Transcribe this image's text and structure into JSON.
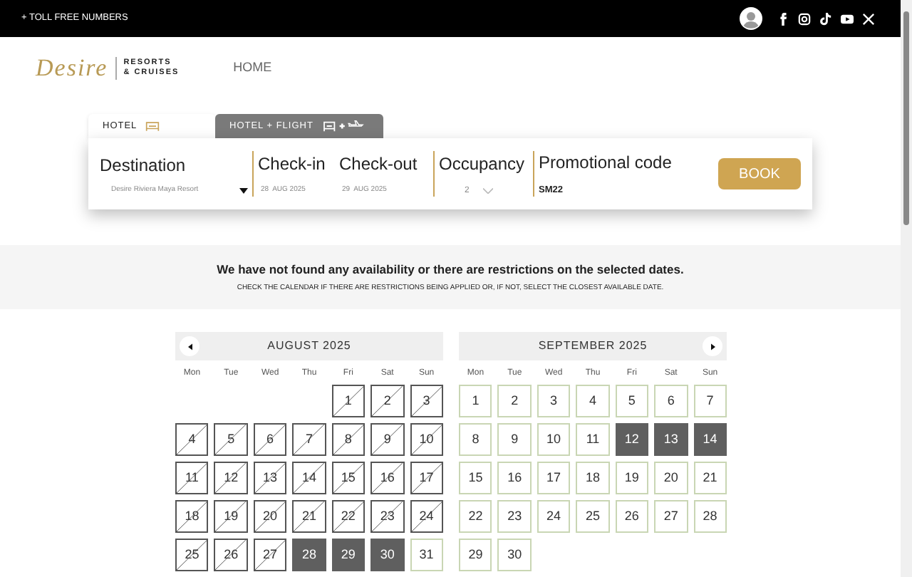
{
  "top_bar": {
    "toll_free": "+ TOLL FREE NUMBERS"
  },
  "header": {
    "logo_script": "Desire",
    "logo_text_1": "RESORTS",
    "logo_text_2": "& CRUISES",
    "nav": [
      "HOME"
    ]
  },
  "tabs": [
    {
      "label": "HOTEL",
      "selected": true
    },
    {
      "label": "HOTEL + FLIGHT",
      "selected": false
    }
  ],
  "search": {
    "destination": {
      "label": "Destination",
      "value": "Desire Riviera Maya Resort"
    },
    "check_in": {
      "label": "Check-in",
      "day": "28",
      "month": "AUG 2025"
    },
    "check_out": {
      "label": "Check-out",
      "day": "29",
      "month": "AUG 2025"
    },
    "occupancy": {
      "label": "Occupancy",
      "value": "2"
    },
    "promo": {
      "label": "Promotional code",
      "value": "SM22"
    },
    "book": "BOOK"
  },
  "notice": {
    "title": "We have not found any availability or there are restrictions on the selected dates.",
    "subtitle": "CHECK THE CALENDAR IF THERE ARE RESTRICTIONS BEING APPLIED OR, IF NOT, SELECT THE CLOSEST AVAILABLE DATE."
  },
  "calendars": [
    {
      "title": "AUGUST 2025",
      "kind": "prev",
      "weekdays": [
        "Mon",
        "Tue",
        "Wed",
        "Thu",
        "Fri",
        "Sat",
        "Sun"
      ],
      "days": [
        {
          "kind": "blank"
        },
        {
          "kind": "blank"
        },
        {
          "kind": "blank"
        },
        {
          "kind": "blank"
        },
        {
          "label": "1",
          "kind": "restricted"
        },
        {
          "label": "2",
          "kind": "restricted"
        },
        {
          "label": "3",
          "kind": "restricted"
        },
        {
          "label": "4",
          "kind": "restricted"
        },
        {
          "label": "5",
          "kind": "restricted"
        },
        {
          "label": "6",
          "kind": "restricted"
        },
        {
          "label": "7",
          "kind": "restricted"
        },
        {
          "label": "8",
          "kind": "restricted"
        },
        {
          "label": "9",
          "kind": "restricted"
        },
        {
          "label": "10",
          "kind": "restricted"
        },
        {
          "label": "11",
          "kind": "restricted"
        },
        {
          "label": "12",
          "kind": "restricted"
        },
        {
          "label": "13",
          "kind": "restricted"
        },
        {
          "label": "14",
          "kind": "restricted"
        },
        {
          "label": "15",
          "kind": "restricted"
        },
        {
          "label": "16",
          "kind": "restricted"
        },
        {
          "label": "17",
          "kind": "restricted"
        },
        {
          "label": "18",
          "kind": "restricted"
        },
        {
          "label": "19",
          "kind": "restricted"
        },
        {
          "label": "20",
          "kind": "restricted"
        },
        {
          "label": "21",
          "kind": "restricted"
        },
        {
          "label": "22",
          "kind": "restricted"
        },
        {
          "label": "23",
          "kind": "restricted"
        },
        {
          "label": "24",
          "kind": "restricted"
        },
        {
          "label": "25",
          "kind": "restricted"
        },
        {
          "label": "26",
          "kind": "restricted"
        },
        {
          "label": "27",
          "kind": "restricted"
        },
        {
          "label": "28",
          "kind": "selected"
        },
        {
          "label": "29",
          "kind": "selected"
        },
        {
          "label": "30",
          "kind": "selected"
        },
        {
          "label": "31",
          "kind": "available"
        }
      ]
    },
    {
      "title": "SEPTEMBER 2025",
      "kind": "next",
      "weekdays": [
        "Mon",
        "Tue",
        "Wed",
        "Thu",
        "Fri",
        "Sat",
        "Sun"
      ],
      "days": [
        {
          "label": "1",
          "kind": "available"
        },
        {
          "label": "2",
          "kind": "available"
        },
        {
          "label": "3",
          "kind": "available"
        },
        {
          "label": "4",
          "kind": "available"
        },
        {
          "label": "5",
          "kind": "available"
        },
        {
          "label": "6",
          "kind": "available"
        },
        {
          "label": "7",
          "kind": "available"
        },
        {
          "label": "8",
          "kind": "available"
        },
        {
          "label": "9",
          "kind": "available"
        },
        {
          "label": "10",
          "kind": "available"
        },
        {
          "label": "11",
          "kind": "available"
        },
        {
          "label": "12",
          "kind": "selected"
        },
        {
          "label": "13",
          "kind": "selected"
        },
        {
          "label": "14",
          "kind": "selected"
        },
        {
          "label": "15",
          "kind": "available"
        },
        {
          "label": "16",
          "kind": "available"
        },
        {
          "label": "17",
          "kind": "available"
        },
        {
          "label": "18",
          "kind": "available"
        },
        {
          "label": "19",
          "kind": "available"
        },
        {
          "label": "20",
          "kind": "available"
        },
        {
          "label": "21",
          "kind": "available"
        },
        {
          "label": "22",
          "kind": "available"
        },
        {
          "label": "23",
          "kind": "available"
        },
        {
          "label": "24",
          "kind": "available"
        },
        {
          "label": "25",
          "kind": "available"
        },
        {
          "label": "26",
          "kind": "available"
        },
        {
          "label": "27",
          "kind": "available"
        },
        {
          "label": "28",
          "kind": "available"
        },
        {
          "label": "29",
          "kind": "available"
        },
        {
          "label": "30",
          "kind": "available"
        }
      ]
    }
  ]
}
